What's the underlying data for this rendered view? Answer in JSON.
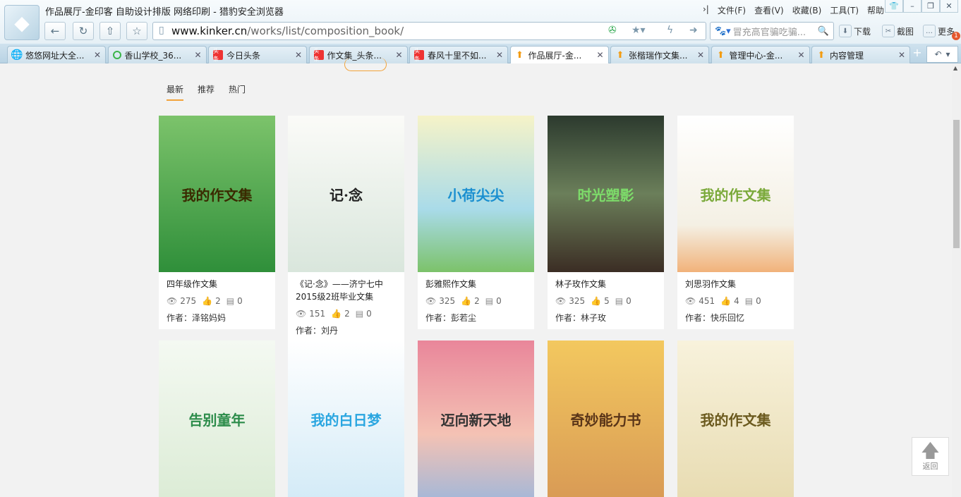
{
  "window": {
    "title": "作品展厅-金印客 自助设计排版 网络印刷 - 猎豹安全浏览器",
    "menu": [
      "文件(F)",
      "查看(V)",
      "收藏(B)",
      "工具(T)",
      "帮助"
    ]
  },
  "toolbar": {
    "url_host": "www.kinker.cn",
    "url_path": "/works/list/composition_book/",
    "search_placeholder": "冒充高官骗吃骗...",
    "download": "下载",
    "screenshot": "截图",
    "more": "更多",
    "badge": "1"
  },
  "tabs": [
    {
      "label": "悠悠网址大全...",
      "icon": "globe"
    },
    {
      "label": "香山学校_36...",
      "icon": "q"
    },
    {
      "label": "今日头条",
      "icon": "toutiao"
    },
    {
      "label": "作文集_头条...",
      "icon": "toutiao"
    },
    {
      "label": "春风十里不如...",
      "icon": "toutiao"
    },
    {
      "label": "作品展厅-金...",
      "icon": "up",
      "active": true
    },
    {
      "label": "张楷瑞作文集...",
      "icon": "up"
    },
    {
      "label": "管理中心-金...",
      "icon": "up"
    },
    {
      "label": "内容管理",
      "icon": "up"
    }
  ],
  "subnav": [
    "最新",
    "推荐",
    "热门"
  ],
  "cards": [
    {
      "cover": "我的作文集",
      "title": "四年级作文集",
      "views": "275",
      "likes": "2",
      "comments": "0",
      "author": "作者：泽铭妈妈",
      "bg": "linear-gradient(#7cc36b,#2f8f3a)",
      "fg": "#3a2a00"
    },
    {
      "cover": "记·念",
      "title": "《记·念》——济宁七中2015级2班毕业文集",
      "views": "151",
      "likes": "2",
      "comments": "0",
      "author": "作者：刘丹",
      "bg": "linear-gradient(#fbfbf8,#d9e6dc)",
      "fg": "#222"
    },
    {
      "cover": "小荷尖尖",
      "title": "彭雅熙作文集",
      "views": "325",
      "likes": "2",
      "comments": "0",
      "author": "作者：彭若尘",
      "bg": "linear-gradient(#f6f3c8,#a9dbe9 60%,#7cc26a)",
      "fg": "#1a8fd0"
    },
    {
      "cover": "时光塑影",
      "title": "林子玫作文集",
      "views": "325",
      "likes": "5",
      "comments": "0",
      "author": "作者：林子玫",
      "bg": "linear-gradient(#2c3a2e,#6b7f5a 50%,#3b2d24)",
      "fg": "#7ddc6a"
    },
    {
      "cover": "我的作文集",
      "title": "刘思羽作文集",
      "views": "451",
      "likes": "4",
      "comments": "0",
      "author": "作者：快乐回忆",
      "bg": "linear-gradient(#fff,#f4f0e4 70%,#f1b27a)",
      "fg": "#7aa93a"
    },
    {
      "cover": "告别童年",
      "bg": "linear-gradient(#f4f9f2,#dcecd6)",
      "fg": "#2c8c4a"
    },
    {
      "cover": "我的白日梦",
      "bg": "linear-gradient(#fff,#d4ebf7)",
      "fg": "#2aa6e0"
    },
    {
      "cover": "迈向新天地",
      "bg": "linear-gradient(#e9869a,#f4c2b4 60%,#a8b8d6)",
      "fg": "#333"
    },
    {
      "cover": "奇妙能力书",
      "bg": "linear-gradient(#f3c85f,#d99b55)",
      "fg": "#5a3518"
    },
    {
      "cover": "我的作文集",
      "bg": "linear-gradient(#f8f2dc,#e8dcb2)",
      "fg": "#6b5a1e"
    }
  ],
  "back_to_top": "返回"
}
